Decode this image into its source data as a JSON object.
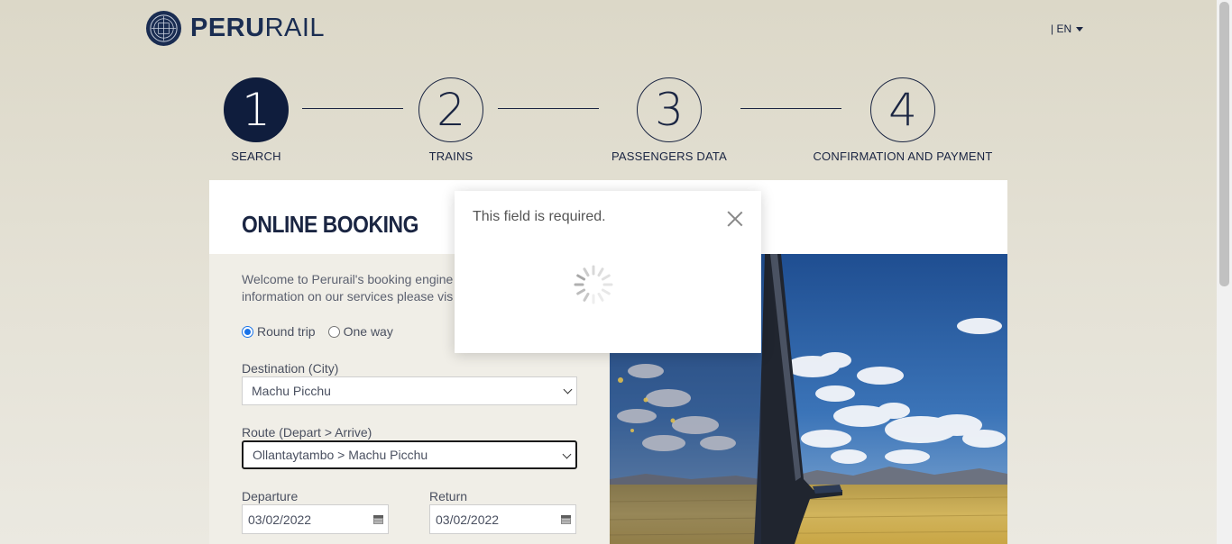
{
  "header": {
    "brand_bold": "PERU",
    "brand_light": "RAIL",
    "language": "| EN"
  },
  "steps": [
    {
      "number": "1",
      "label": "SEARCH",
      "active": true
    },
    {
      "number": "2",
      "label": "TRAINS",
      "active": false
    },
    {
      "number": "3",
      "label": "PASSENGERS DATA",
      "active": false
    },
    {
      "number": "4",
      "label": "CONFIRMATION AND PAYMENT",
      "active": false
    }
  ],
  "booking": {
    "title": "ONLINE BOOKING",
    "intro_line1": "Welcome to Perurail's booking engine",
    "intro_line2": "information on our services please vis",
    "trip_types": {
      "round_trip": "Round trip",
      "one_way": "One way",
      "selected": "round_trip"
    },
    "destination_label": "Destination (City)",
    "destination_value": "Machu Picchu",
    "route_label": "Route (Depart > Arrive)",
    "route_value": "Ollantaytambo > Machu Picchu",
    "departure_label": "Departure",
    "departure_value": "03/02/2022",
    "return_label": "Return",
    "return_value": "03/02/2022"
  },
  "modal": {
    "message": "This field is required."
  },
  "colors": {
    "brand_navy": "#1a2d52",
    "active_step": "#0f1d3d",
    "radio_checked": "#1a73e8"
  }
}
